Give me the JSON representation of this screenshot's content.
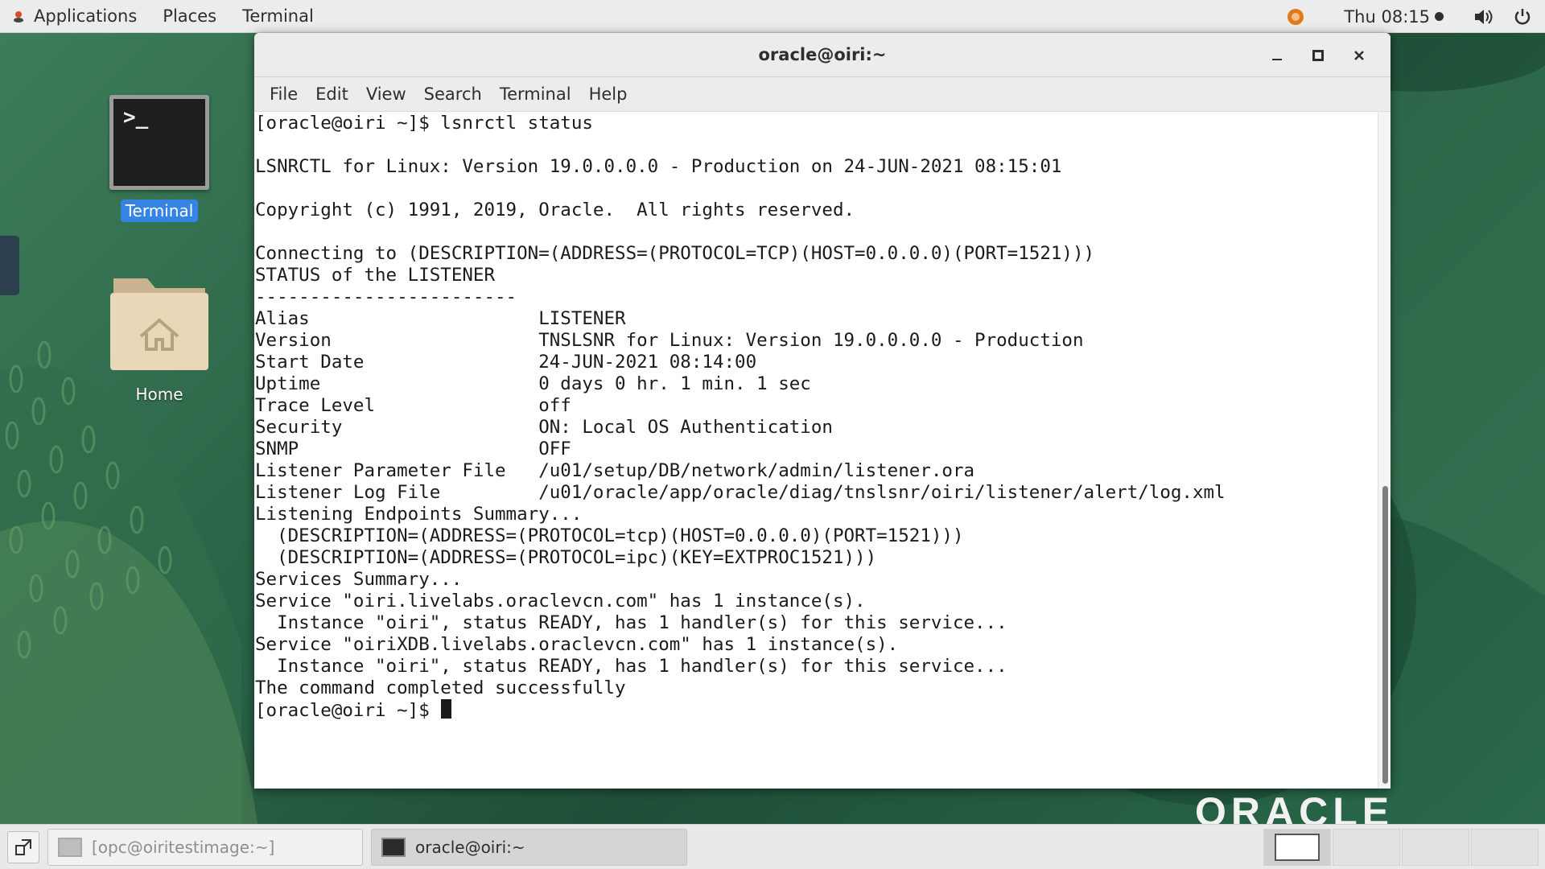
{
  "topbar": {
    "menu": [
      "Applications",
      "Places",
      "Terminal"
    ],
    "clock": "Thu 08:15",
    "icons": [
      "app-logo-icon",
      "status-emblem-icon",
      "volume-icon",
      "power-icon"
    ]
  },
  "desktop": {
    "icons": [
      {
        "label": "Terminal",
        "icon": "terminal-icon"
      },
      {
        "label": "Home",
        "icon": "home-folder-icon"
      }
    ],
    "watermark": "ORACLE"
  },
  "window": {
    "title": "oracle@oiri:~",
    "menubar": [
      "File",
      "Edit",
      "View",
      "Search",
      "Terminal",
      "Help"
    ],
    "terminal_lines": [
      "[oracle@oiri ~]$ lsnrctl status",
      "",
      "LSNRCTL for Linux: Version 19.0.0.0.0 - Production on 24-JUN-2021 08:15:01",
      "",
      "Copyright (c) 1991, 2019, Oracle.  All rights reserved.",
      "",
      "Connecting to (DESCRIPTION=(ADDRESS=(PROTOCOL=TCP)(HOST=0.0.0.0)(PORT=1521)))",
      "STATUS of the LISTENER",
      "------------------------",
      "Alias                     LISTENER",
      "Version                   TNSLSNR for Linux: Version 19.0.0.0.0 - Production",
      "Start Date                24-JUN-2021 08:14:00",
      "Uptime                    0 days 0 hr. 1 min. 1 sec",
      "Trace Level               off",
      "Security                  ON: Local OS Authentication",
      "SNMP                      OFF",
      "Listener Parameter File   /u01/setup/DB/network/admin/listener.ora",
      "Listener Log File         /u01/oracle/app/oracle/diag/tnslsnr/oiri/listener/alert/log.xml",
      "Listening Endpoints Summary...",
      "  (DESCRIPTION=(ADDRESS=(PROTOCOL=tcp)(HOST=0.0.0.0)(PORT=1521)))",
      "  (DESCRIPTION=(ADDRESS=(PROTOCOL=ipc)(KEY=EXTPROC1521)))",
      "Services Summary...",
      "Service \"oiri.livelabs.oraclevcn.com\" has 1 instance(s).",
      "  Instance \"oiri\", status READY, has 1 handler(s) for this service...",
      "Service \"oiriXDB.livelabs.oraclevcn.com\" has 1 instance(s).",
      "  Instance \"oiri\", status READY, has 1 handler(s) for this service...",
      "The command completed successfully"
    ],
    "prompt": "[oracle@oiri ~]$ "
  },
  "taskbar": {
    "tasks": [
      {
        "label": "[opc@oiritestimage:~]",
        "active": false
      },
      {
        "label": "oracle@oiri:~",
        "active": true
      }
    ],
    "workspaces": 4
  }
}
